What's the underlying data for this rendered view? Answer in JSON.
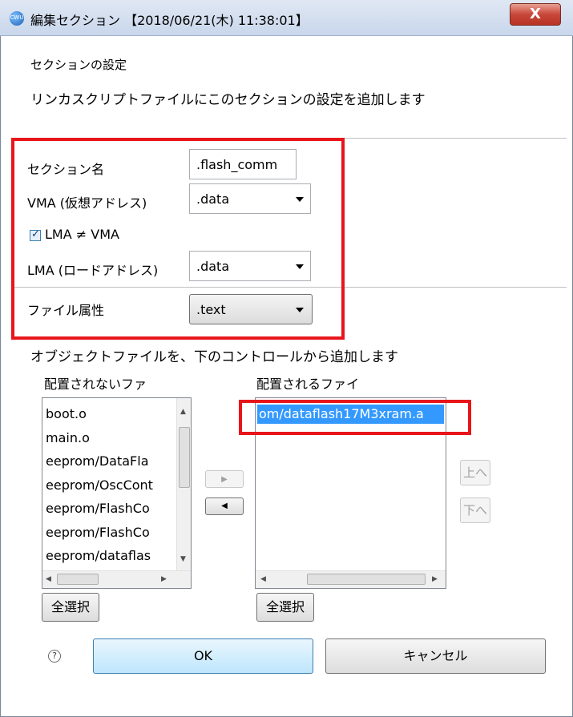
{
  "window": {
    "title": "編集セクション 【2018/06/21(木) 11:38:01】",
    "close_label": "X",
    "app_icon_label": "CWU"
  },
  "header": {
    "title": "セクションの設定",
    "description": "リンカスクリプトファイルにこのセクションの設定を追加します"
  },
  "form": {
    "section_name_label": "セクション名",
    "section_name_value": ".flash_comm",
    "vma_label": "VMA (仮想アドレス)",
    "vma_value": ".data",
    "lma_neq_vma_label": "LMA ≠ VMA",
    "lma_neq_vma_checked": true,
    "lma_label": "LMA (ロードアドレス)",
    "lma_value": ".data",
    "file_attr_label": "ファイル属性",
    "file_attr_value": ".text"
  },
  "objects": {
    "instruction": "オブジェクトファイルを、下のコントロールから追加します",
    "unplaced_header": "配置されないファ",
    "placed_header": "配置されるファイ",
    "unplaced_items": [
      "boot.o",
      "main.o",
      "eeprom/DataFla",
      "eeprom/OscCont",
      "eeprom/FlashCo",
      "eeprom/FlashCo",
      "eeprom/dataflas"
    ],
    "placed_items": [
      "om/dataflash17M3xram.a"
    ],
    "select_all_label": "全選択",
    "select_all_label_2": "全選択",
    "add_arrow": "▶",
    "remove_arrow": "◀",
    "up_label": "上へ",
    "down_label": "下へ"
  },
  "footer": {
    "help_icon": "?",
    "ok_label": "OK",
    "cancel_label": "キャンセル"
  },
  "colors": {
    "highlight_red": "#e8151b",
    "selection_blue": "#3399ff",
    "ok_blue": "#bee6fd"
  }
}
